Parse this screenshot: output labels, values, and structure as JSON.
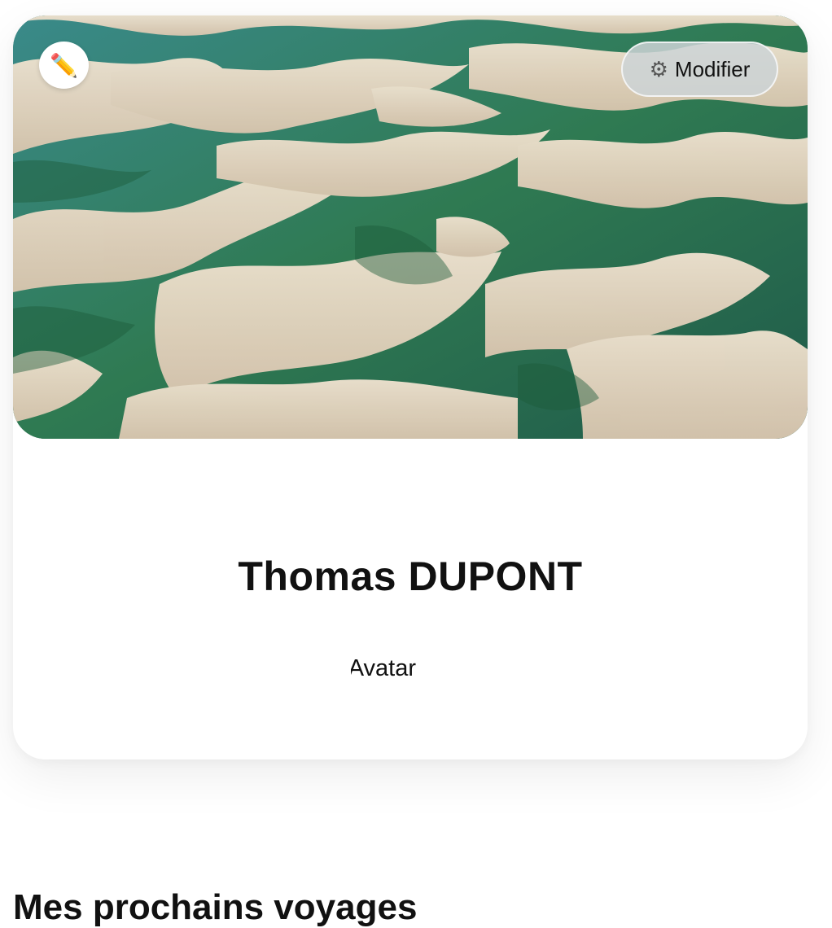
{
  "profile": {
    "cover_image": "aerial-dunes-lagoons",
    "edit_icon": "pencil-icon",
    "modify_button": {
      "icon": "gear-icon",
      "label": "Modifier"
    },
    "name": "Thomas DUPONT",
    "avatar_alt": "Avatar",
    "colors": {
      "sand": "#e6d6c2",
      "lagoon_green": "#2f7a52",
      "lagoon_blue": "#2e6f78",
      "card_bg": "#ffffff"
    }
  },
  "sections": {
    "upcoming_trips_title": "Mes prochains voyages"
  }
}
